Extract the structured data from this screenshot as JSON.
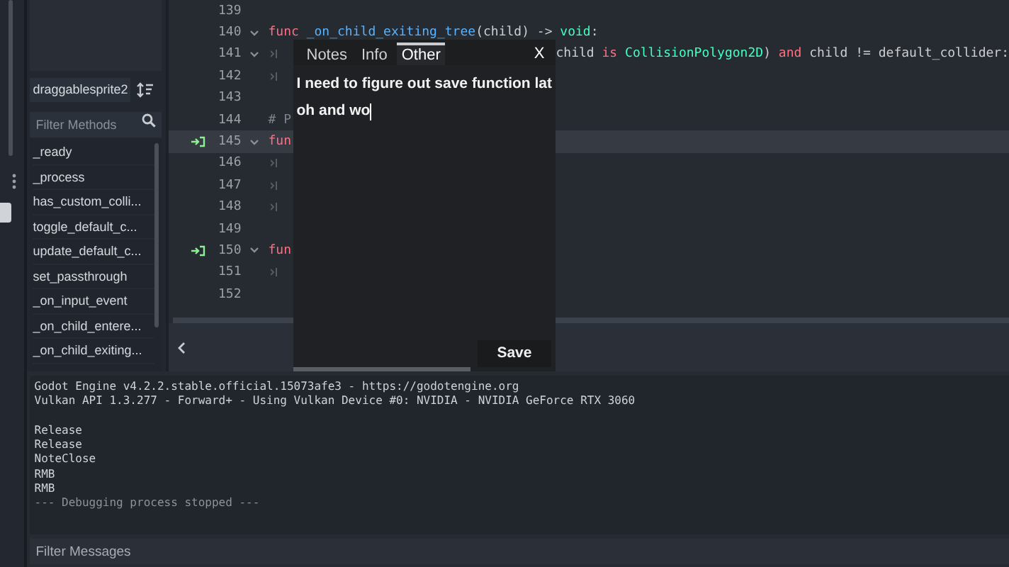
{
  "methods_panel": {
    "script_name": "draggablesprite2",
    "filter": {
      "placeholder": "Filter Methods"
    },
    "methods": [
      "_ready",
      "_process",
      "has_custom_colli...",
      "toggle_default_c...",
      "update_default_c...",
      "set_passthrough",
      "_on_input_event",
      "_on_child_entere...",
      "_on_child_exiting..."
    ]
  },
  "code_editor": {
    "lines": [
      {
        "number": "139",
        "fold": false,
        "signal": false,
        "tab": false,
        "highlighted": false
      },
      {
        "number": "140",
        "fold": true,
        "signal": false,
        "tab": false,
        "highlighted": false,
        "left": [
          {
            "t": "func ",
            "color": "#ff7085"
          },
          {
            "t": "_on_child_exiting_tree",
            "color": "#57b3ff"
          },
          {
            "t": "(child) -> ",
            "color": "#cdcfd2"
          },
          {
            "t": "void",
            "color": "#42ffc2"
          },
          {
            "t": ":",
            "color": "#cdcfd2"
          }
        ]
      },
      {
        "number": "141",
        "fold": true,
        "signal": false,
        "tab": true,
        "highlighted": false,
        "right": [
          {
            "t": "child ",
            "color": "#cdcfd2"
          },
          {
            "t": "is ",
            "color": "#ff7085"
          },
          {
            "t": "CollisionPolygon2D",
            "color": "#42ffc2"
          },
          {
            "t": ") ",
            "color": "#cdcfd2"
          },
          {
            "t": "and ",
            "color": "#ff7085"
          },
          {
            "t": "child != default_collider:",
            "color": "#cdcfd2"
          }
        ]
      },
      {
        "number": "142",
        "fold": false,
        "signal": false,
        "tab": true,
        "highlighted": false
      },
      {
        "number": "143",
        "fold": false,
        "signal": false,
        "tab": false,
        "highlighted": false
      },
      {
        "number": "144",
        "fold": false,
        "signal": false,
        "tab": false,
        "highlighted": false,
        "left": [
          {
            "t": "# P",
            "color": "#7f8590"
          }
        ]
      },
      {
        "number": "145",
        "fold": true,
        "signal": true,
        "tab": false,
        "highlighted": true,
        "left": [
          {
            "t": "fun",
            "color": "#ff7085"
          }
        ]
      },
      {
        "number": "146",
        "fold": false,
        "signal": false,
        "tab": true,
        "highlighted": false
      },
      {
        "number": "147",
        "fold": false,
        "signal": false,
        "tab": true,
        "highlighted": false
      },
      {
        "number": "148",
        "fold": false,
        "signal": false,
        "tab": true,
        "highlighted": false
      },
      {
        "number": "149",
        "fold": false,
        "signal": false,
        "tab": false,
        "highlighted": false
      },
      {
        "number": "150",
        "fold": true,
        "signal": true,
        "tab": false,
        "highlighted": false,
        "left": [
          {
            "t": "fun",
            "color": "#ff7085"
          }
        ]
      },
      {
        "number": "151",
        "fold": false,
        "signal": false,
        "tab": true,
        "highlighted": false
      },
      {
        "number": "152",
        "fold": false,
        "signal": false,
        "tab": false,
        "highlighted": false
      }
    ]
  },
  "note_popup": {
    "tabs": [
      {
        "label": "Notes",
        "selected": false
      },
      {
        "label": "Info",
        "selected": false
      },
      {
        "label": "Other",
        "selected": true
      }
    ],
    "close": "X",
    "text_lines": [
      "I need to figure out save function lat",
      "oh and wo"
    ],
    "save": "Save"
  },
  "output": {
    "blocks": [
      [
        {
          "text": "Godot Engine v4.2.2.stable.official.15073afe3 - https://godotengine.org",
          "dim": false
        },
        {
          "text": "Vulkan API 1.3.277 - Forward+ - Using Vulkan Device #0: NVIDIA - NVIDIA GeForce RTX 3060",
          "dim": false
        }
      ],
      [
        {
          "text": "Release",
          "dim": false
        },
        {
          "text": "Release",
          "dim": false
        },
        {
          "text": "NoteClose",
          "dim": false
        },
        {
          "text": "RMB",
          "dim": false
        },
        {
          "text": "RMB",
          "dim": false
        },
        {
          "text": "--- Debugging process stopped ---",
          "dim": true
        }
      ]
    ],
    "filter": {
      "placeholder": "Filter Messages"
    }
  }
}
